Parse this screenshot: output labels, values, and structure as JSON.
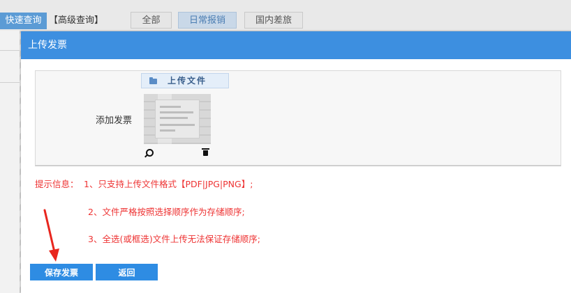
{
  "topbar": {
    "quick_query": "快速查询",
    "advanced_query": "【高级查询】",
    "tabs": [
      {
        "label": "全部",
        "active": false
      },
      {
        "label": "日常报销",
        "active": true
      },
      {
        "label": "国内差旅",
        "active": false
      }
    ]
  },
  "dialog": {
    "title": "上传发票",
    "form": {
      "add_invoice_label": "添加发票",
      "upload_button_label": "上传文件"
    },
    "tips": {
      "label": "提示信息：",
      "items": [
        "1、只支持上传文件格式【PDF|JPG|PNG】;",
        "2、文件严格按照选择顺序作为存储顺序;",
        "3、全选(或框选)文件上传无法保证存储顺序;"
      ]
    },
    "buttons": {
      "save": "保存发票",
      "back": "返回"
    }
  },
  "colors": {
    "header_blue": "#3d8fe0",
    "button_blue": "#2e8ce3",
    "tip_red": "#ee3333",
    "annotation_arrow": "#e8261e"
  },
  "icons": [
    "folder-icon",
    "zoom-icon",
    "trash-icon"
  ]
}
